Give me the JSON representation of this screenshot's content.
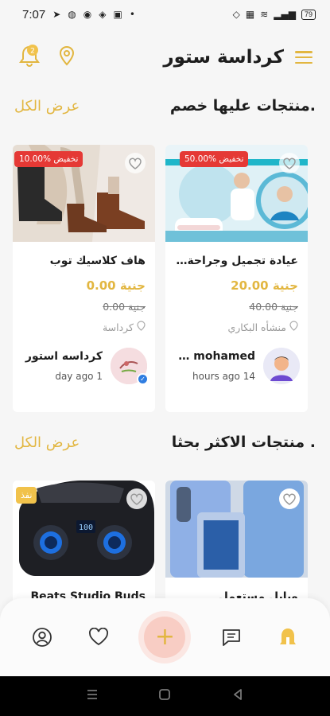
{
  "status_bar": {
    "time": "7:07",
    "battery": "79"
  },
  "header": {
    "title": "كرداسة ستور"
  },
  "sections": [
    {
      "title": "منتجات عليها خصم.",
      "view_all": "عرض الكل"
    },
    {
      "title": "منتجات الاكثر بحثا .",
      "view_all": "عرض الكل"
    }
  ],
  "discount_products": [
    {
      "badge": "50.00% تخفيض",
      "name": "عيادة تجميل وجراحة الف...",
      "price": "جنية 20.00",
      "old_price": "جنية 40.00",
      "location": "منشأه البكاري",
      "seller_name": "Dr mohamed ...",
      "seller_time": "14 hours ago"
    },
    {
      "badge": "10.00% تخفيض",
      "name": "هاف كلاسيك توب",
      "price": "جنية 0.00",
      "old_price": "جنية 0.00",
      "location": "كرداسة",
      "seller_name": "كرداسه استور",
      "seller_time": "1 day ago"
    }
  ],
  "popular_products": [
    {
      "name": "وبايل مستعمل"
    },
    {
      "name": "Beats Studio Buds",
      "badge": "نفذ"
    }
  ],
  "icons": {
    "menu": "menu-icon",
    "location": "location-pin-icon",
    "notification": "bell-icon",
    "heart": "heart-icon",
    "profile": "user-circle-icon",
    "favorites": "heart-outline-icon",
    "add": "plus-icon",
    "chat": "chat-icon",
    "home": "home-icon"
  },
  "colors": {
    "accent": "#e2b640",
    "discount": "#e53935",
    "verified": "#2f7de1",
    "fab": "#f8cdc4"
  }
}
